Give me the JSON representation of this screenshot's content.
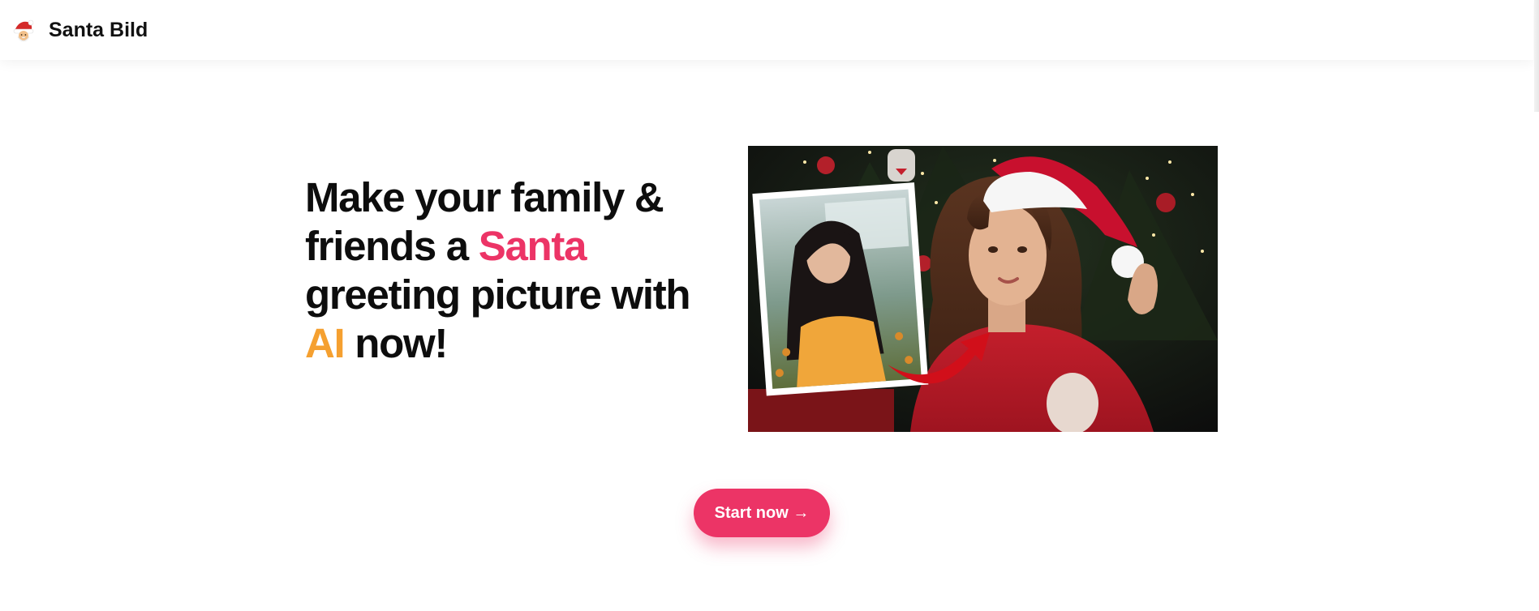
{
  "header": {
    "logo_icon": "santa-emoji-icon",
    "brand_name": "Santa Bild"
  },
  "hero": {
    "title_part1": "Make your family & friends a ",
    "title_highlight1": "Santa",
    "title_part2": " greeting picture with ",
    "title_highlight2": "AI",
    "title_part3": " now!",
    "image_icons": [
      "before-photo",
      "red-arrow-icon",
      "santa-hat-portrait"
    ]
  },
  "cta": {
    "label": "Start now →"
  },
  "colors": {
    "accent_pink": "#ec3466",
    "accent_orange": "#f5a030",
    "text_dark": "#0d0d0d",
    "santa_red": "#c8102e"
  }
}
